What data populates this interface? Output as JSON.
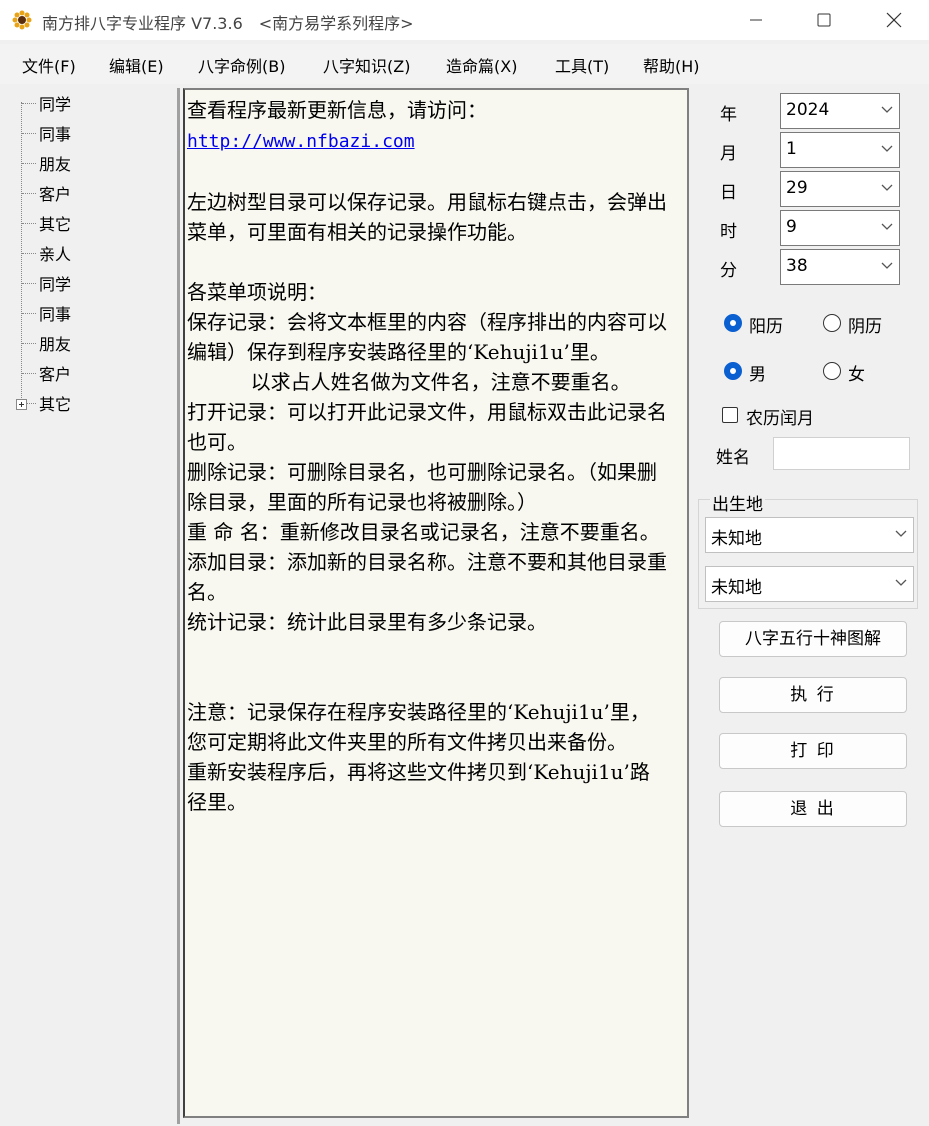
{
  "window": {
    "title": "南方排八字专业程序 V7.3.6",
    "subtitle": "<南方易学系列程序>"
  },
  "menu": [
    {
      "label": "文件(F)"
    },
    {
      "label": "编辑(E)"
    },
    {
      "label": "八字命例(B)"
    },
    {
      "label": "八字知识(Z)"
    },
    {
      "label": "造命篇(X)"
    },
    {
      "label": "工具(T)"
    },
    {
      "label": "帮助(H)"
    }
  ],
  "tree": {
    "items": [
      {
        "label": "同学"
      },
      {
        "label": "同事"
      },
      {
        "label": "朋友"
      },
      {
        "label": "客户"
      },
      {
        "label": "其它"
      },
      {
        "label": "亲人"
      },
      {
        "label": "同学"
      },
      {
        "label": "同事"
      },
      {
        "label": "朋友"
      },
      {
        "label": "客户"
      },
      {
        "label": "其它"
      }
    ]
  },
  "content": {
    "line1": "查看程序最新更新信息，请访问：",
    "link": "http://www.nfbazi.com",
    "para1": "左边树型目录可以保存记录。用鼠标右键点击，会弹出菜单，可里面有相关的记录操作功能。",
    "para2": "各菜单项说明：\n保存记录：会将文本框里的内容（程序排出的内容可以编辑）保存到程序安装路径里的‘Kehuji1u’里。\n          以求占人姓名做为文件名，注意不要重名。\n打开记录：可以打开此记录文件，用鼠标双击此记录名也可。\n删除记录：可删除目录名，也可删除记录名。（如果删除目录，里面的所有记录也将被删除。）\n重 命 名：重新修改目录名或记录名，注意不要重名。\n添加目录：添加新的目录名称。注意不要和其他目录重名。\n统计记录：统计此目录里有多少条记录。",
    "para3": "注意：记录保存在程序安装路径里的‘Kehuji1u’里，您可定期将此文件夹里的所有文件拷贝出来备份。\n重新安装程序后，再将这些文件拷贝到‘Kehuji1u’路径里。"
  },
  "form": {
    "year": {
      "label": "年",
      "value": "2024"
    },
    "month": {
      "label": "月",
      "value": "1"
    },
    "day": {
      "label": "日",
      "value": "29"
    },
    "hour": {
      "label": "时",
      "value": "9"
    },
    "minute": {
      "label": "分",
      "value": "38"
    },
    "calendar_solar": "阳历",
    "calendar_lunar": "阴历",
    "gender_male": "男",
    "gender_female": "女",
    "leap_month": "农历闰月",
    "name_label": "姓名",
    "name_value": "",
    "birthplace_label": "出生地",
    "birthplace_1": "未知地",
    "birthplace_2": "未知地",
    "selected_calendar": "阳历",
    "selected_gender": "男",
    "leap_month_checked": false
  },
  "buttons": {
    "diagram": "八字五行十神图解",
    "execute": "执 行",
    "print": "打 印",
    "exit": "退 出"
  },
  "colors": {
    "accent": "#0a5fd1",
    "link": "#0000ee",
    "text_bg": "#f8f8f0"
  }
}
